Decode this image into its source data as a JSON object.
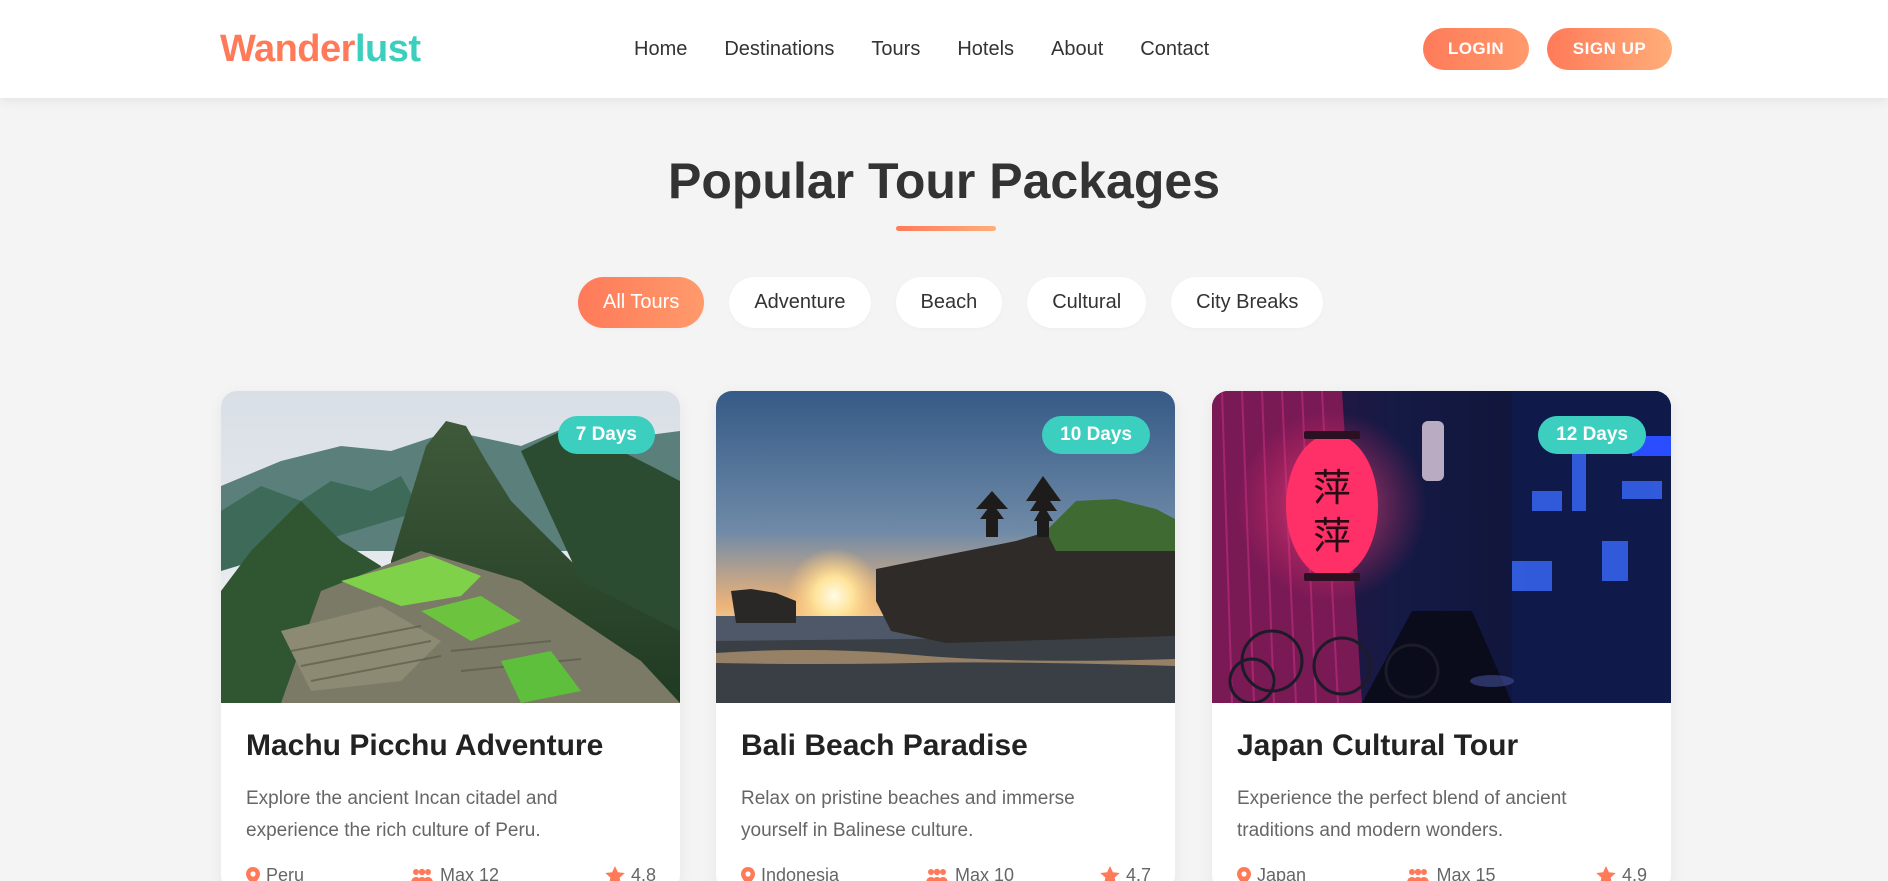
{
  "header": {
    "logo_part1": "Wander",
    "logo_part2": "lust",
    "nav": [
      "Home",
      "Destinations",
      "Tours",
      "Hotels",
      "About",
      "Contact"
    ],
    "login_label": "LOGIN",
    "signup_label": "SIGN UP"
  },
  "section": {
    "title": "Popular Tour Packages",
    "filters": [
      "All Tours",
      "Adventure",
      "Beach",
      "Cultural",
      "City Breaks"
    ],
    "active_filter": "All Tours"
  },
  "tours": [
    {
      "duration": "7 Days",
      "title": "Machu Picchu Adventure",
      "description": "Explore the ancient Incan citadel and experience the rich culture of Peru.",
      "location": "Peru",
      "group": "Max 12",
      "rating": "4.8",
      "image": "mountain-ruins-photo"
    },
    {
      "duration": "10 Days",
      "title": "Bali Beach Paradise",
      "description": "Relax on pristine beaches and immerse yourself in Balinese culture.",
      "location": "Indonesia",
      "group": "Max 10",
      "rating": "4.7",
      "image": "temple-sunset-photo"
    },
    {
      "duration": "12 Days",
      "title": "Japan Cultural Tour",
      "description": "Experience the perfect blend of ancient traditions and modern wonders.",
      "location": "Japan",
      "group": "Max 15",
      "rating": "4.9",
      "image": "lantern-alley-photo"
    }
  ],
  "lantern_text": "萍\n萍",
  "colors": {
    "accent": "#ff7a59",
    "teal": "#3ccfc0",
    "background": "#f4f4f4"
  },
  "icons": {
    "location": "map-pin-icon",
    "group": "users-icon",
    "rating": "star-icon"
  }
}
